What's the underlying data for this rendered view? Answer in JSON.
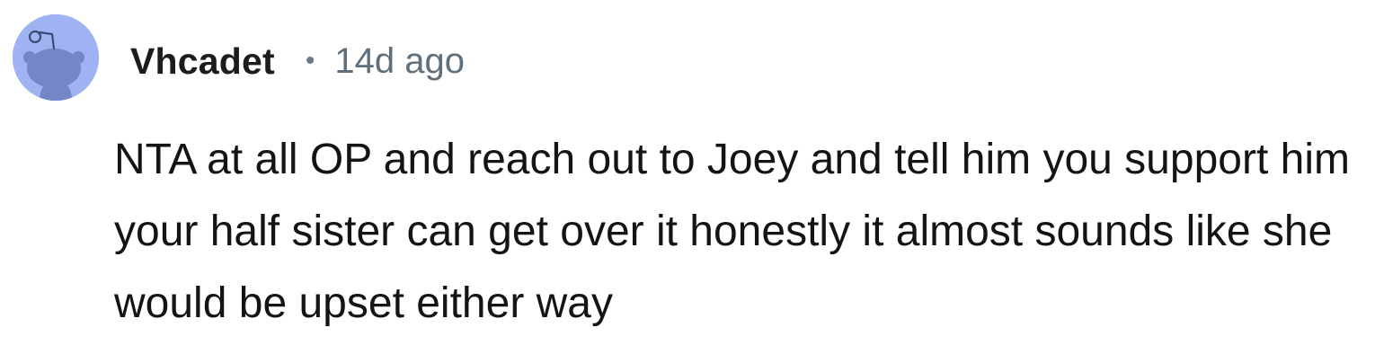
{
  "comment": {
    "avatar_icon": "reddit-snoo-avatar-icon",
    "username": "Vhcadet",
    "separator": "•",
    "timestamp": "14d ago",
    "text": "NTA at all OP and reach out to Joey and tell him you support him your half sister can get over it honestly it almost sounds like she would be upset either way"
  },
  "colors": {
    "avatar_bg": "#9fb3f3",
    "avatar_figure": "#6b7fbf",
    "username": "#1c1c1c",
    "meta": "#5f6f7c",
    "body": "#141414"
  }
}
